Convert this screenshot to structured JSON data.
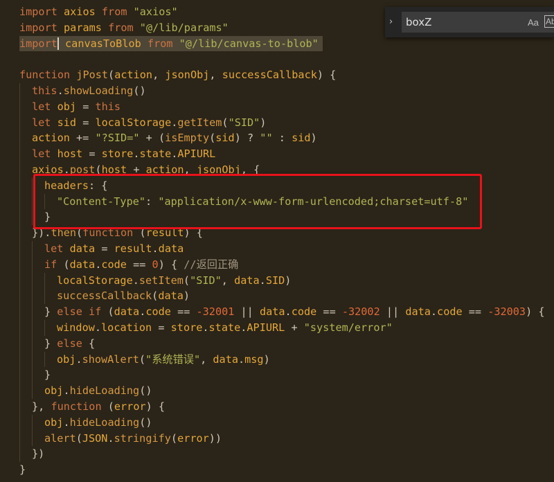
{
  "find": {
    "query": "boxZ",
    "toggle_glyph": "›",
    "match_case_label": "Aa",
    "whole_word_label": "Ab"
  },
  "code": {
    "l1": [
      "import",
      "axios",
      "from",
      "\"axios\""
    ],
    "l2": [
      "import",
      "params",
      "from",
      "\"@/lib/params\""
    ],
    "l3": [
      "import",
      "canvasToBlob",
      "from",
      "\"@/lib/canvas-to-blob\""
    ],
    "l5": [
      "function",
      "jPost",
      "(",
      "action",
      ",",
      "jsonObj",
      ",",
      "successCallback",
      ") {"
    ],
    "l6": [
      "this",
      ".",
      "showLoading",
      "()"
    ],
    "l7": [
      "let",
      "obj",
      "=",
      "this"
    ],
    "l8": [
      "let",
      "sid",
      "=",
      "localStorage",
      ".",
      "getItem",
      "(",
      "\"SID\"",
      ")"
    ],
    "l9": [
      "action",
      "+=",
      "\"?SID=\"",
      "+ (",
      "isEmpty",
      "(",
      "sid",
      ") ?",
      "\"\"",
      ":",
      "sid",
      ")"
    ],
    "l10": [
      "let",
      "host",
      "=",
      "store",
      ".",
      "state",
      ".",
      "APIURL"
    ],
    "l11": [
      "axios",
      ".",
      "post",
      "(",
      "host",
      "+",
      "action",
      ",",
      "jsonObj",
      ", {"
    ],
    "l12": [
      "headers",
      ": {"
    ],
    "l13": [
      "\"Content-Type\"",
      ":",
      "\"application/x-www-form-urlencoded;charset=utf-8\""
    ],
    "l14": [
      "}"
    ],
    "l15": [
      "}).",
      "then",
      "(",
      "function",
      "(",
      "result",
      ") {"
    ],
    "l16": [
      "let",
      "data",
      "=",
      "result",
      ".",
      "data"
    ],
    "l17": [
      "if",
      "(",
      "data",
      ".",
      "code",
      "==",
      "0",
      ") {",
      "//返回正确"
    ],
    "l18": [
      "localStorage",
      ".",
      "setItem",
      "(",
      "\"SID\"",
      ",",
      "data",
      ".",
      "SID",
      ")"
    ],
    "l19": [
      "successCallback",
      "(",
      "data",
      ")"
    ],
    "l20": [
      "} ",
      "else",
      " ",
      "if",
      " (",
      "data",
      ".",
      "code",
      " == ",
      "-32001",
      " || ",
      "data",
      ".",
      "code",
      " == ",
      "-32002",
      " || ",
      "data",
      ".",
      "code",
      " == ",
      "-32003",
      ") {"
    ],
    "l21": [
      "window",
      ".",
      "location",
      "=",
      "store",
      ".",
      "state",
      ".",
      "APIURL",
      "+",
      "\"system/error\""
    ],
    "l22": [
      "} ",
      "else",
      " {"
    ],
    "l23": [
      "obj",
      ".",
      "showAlert",
      "(",
      "\"系统错误\"",
      ",",
      "data",
      ".",
      "msg",
      ")"
    ],
    "l24": [
      "}"
    ],
    "l25": [
      "obj",
      ".",
      "hideLoading",
      "()"
    ],
    "l26": [
      "}, ",
      "function",
      " (",
      "error",
      ") {"
    ],
    "l27": [
      "obj",
      ".",
      "hideLoading",
      "()"
    ],
    "l28": [
      "alert",
      "(",
      "JSON",
      ".",
      "stringify",
      "(",
      "error",
      "))"
    ],
    "l29": [
      "})"
    ],
    "l30": [
      "}"
    ]
  }
}
